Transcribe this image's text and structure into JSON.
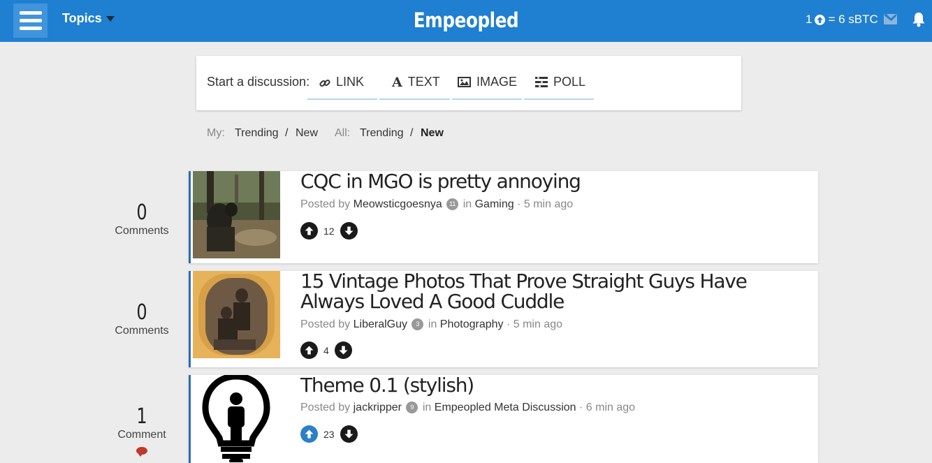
{
  "header": {
    "topics_label": "Topics",
    "brand": "Empeopled",
    "rate_left": "1",
    "rate_right": "= 6 sBTC"
  },
  "start": {
    "label": "Start a discussion:",
    "buttons": [
      "LINK",
      "TEXT",
      "IMAGE",
      "POLL"
    ]
  },
  "filters": {
    "my_label": "My:",
    "my_trending": "Trending",
    "sep": "/",
    "my_new": "New",
    "all_label": "All:",
    "all_trending": "Trending",
    "all_new": "New"
  },
  "posts": [
    {
      "comments_count": "0",
      "comments_label": "Comments",
      "title": "CQC in MGO is pretty annoying",
      "posted_by": "Posted by",
      "user": "Meowsticgoesnya",
      "user_level": "11",
      "in_label": "in",
      "topic": "Gaming",
      "time": "· 5 min ago",
      "votes": "12"
    },
    {
      "comments_count": "0",
      "comments_label": "Comments",
      "title": "15 Vintage Photos That Prove Straight Guys Have Always Loved A Good Cuddle",
      "posted_by": "Posted by",
      "user": "LiberalGuy",
      "user_level": "3",
      "in_label": "in",
      "topic": "Photography",
      "time": "· 5 min ago",
      "votes": "4"
    },
    {
      "comments_count": "1",
      "comments_label": "Comment",
      "title": "Theme 0.1 (stylish)",
      "posted_by": "Posted by",
      "user": "jackripper",
      "user_level": "9",
      "in_label": "in",
      "topic": "Empeopled Meta Discussion",
      "time": "· 6 min ago",
      "votes": "23"
    }
  ],
  "colors": {
    "header_bg": "#1f7fd1",
    "accent": "#2a7fc7",
    "comment_icon": "#c0392b"
  }
}
